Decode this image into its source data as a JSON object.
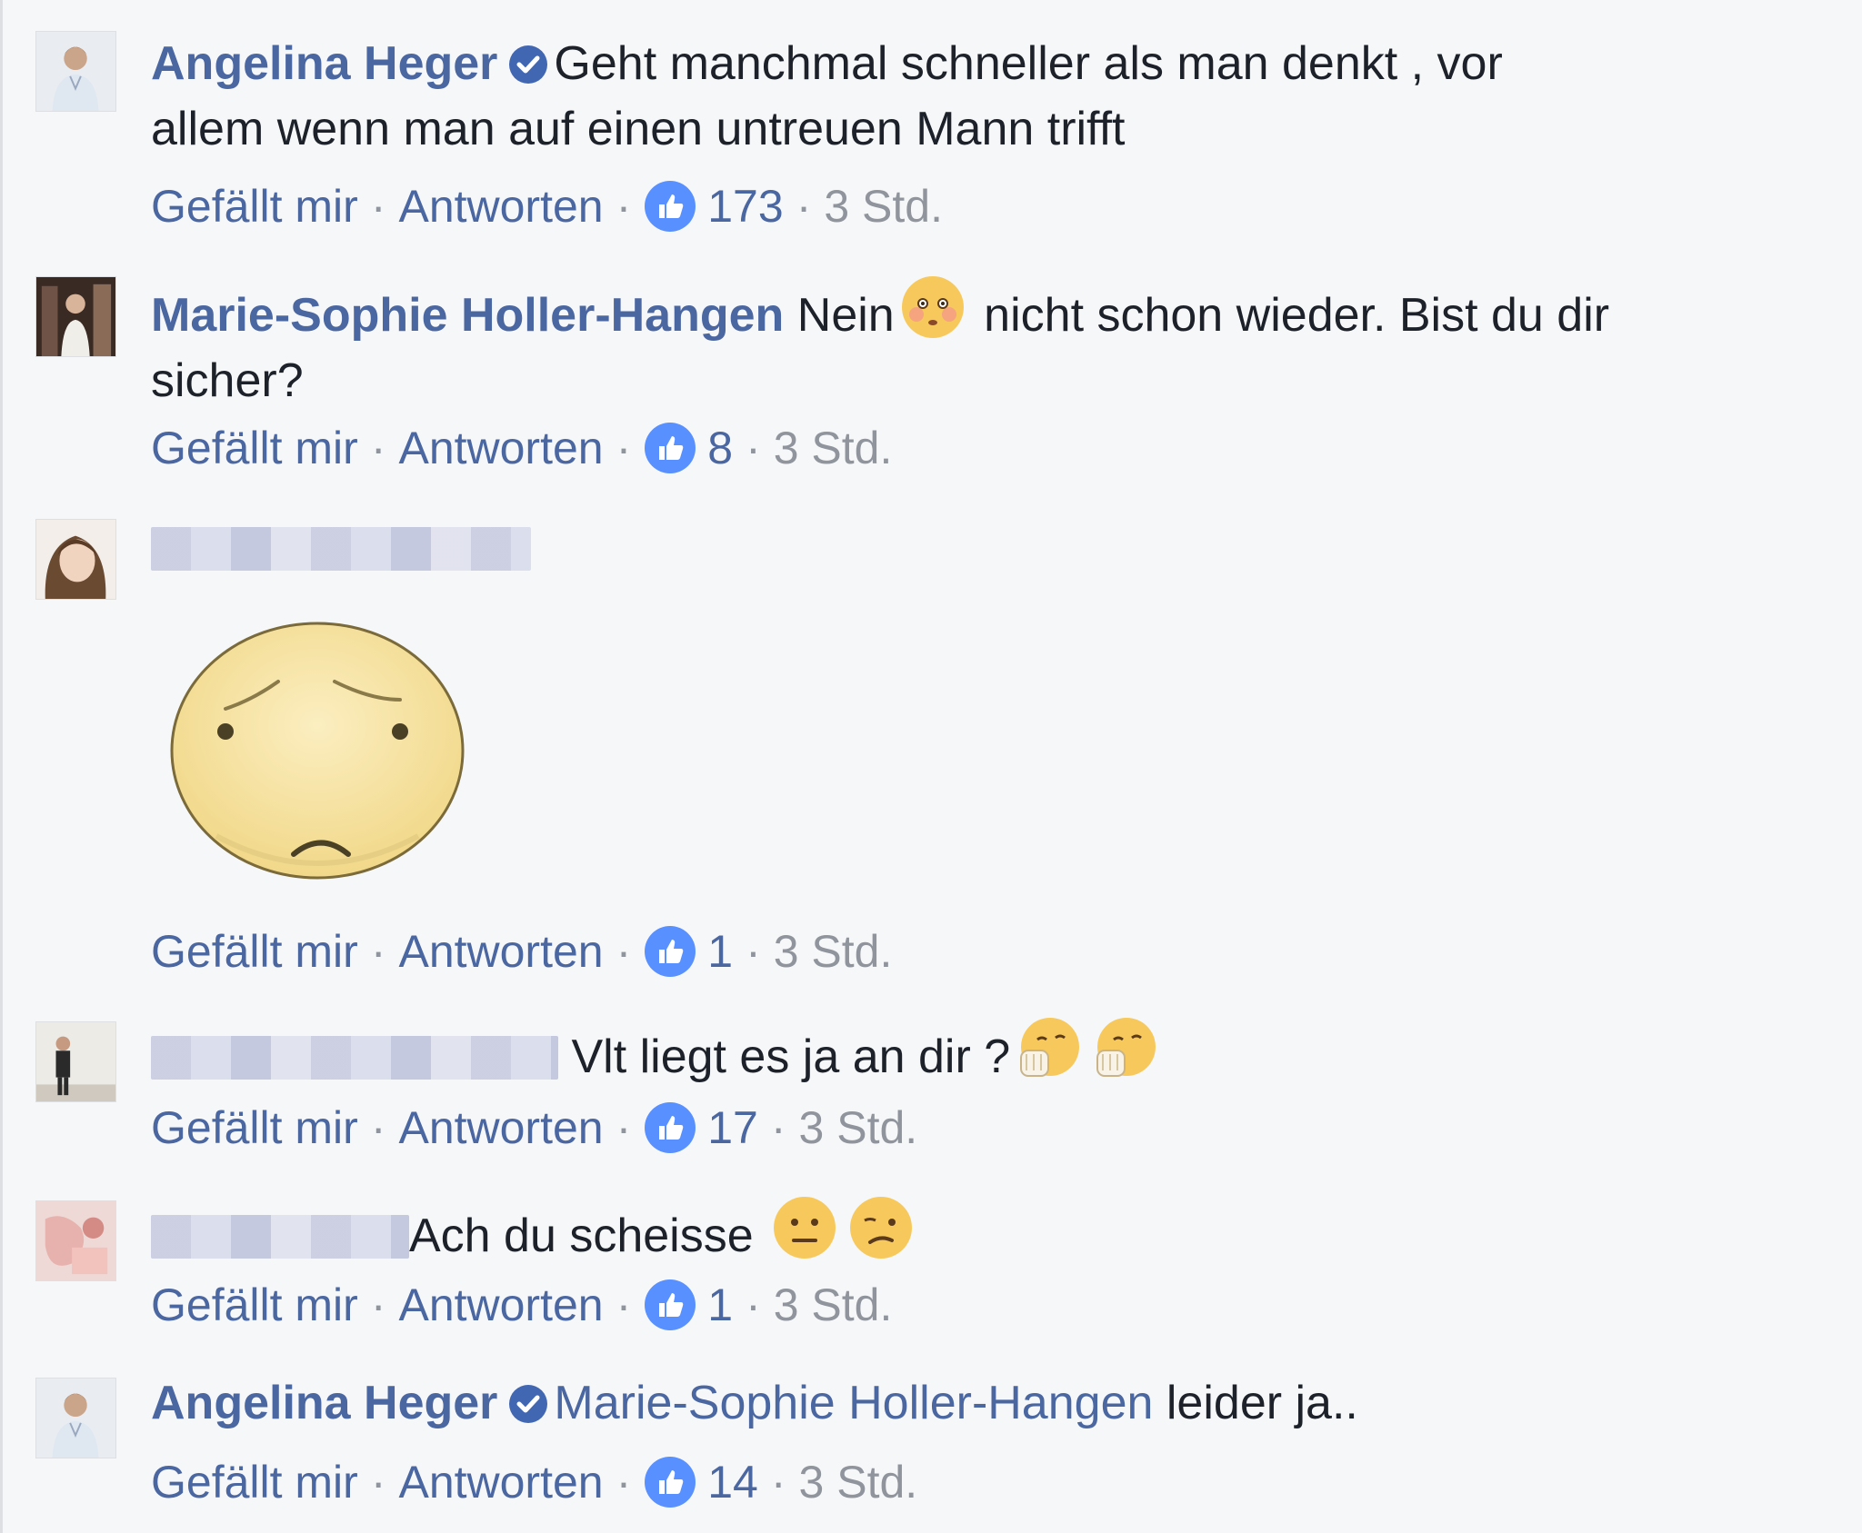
{
  "comments": [
    {
      "author": "Angelina Heger",
      "verified": true,
      "text_line1": "Geht manchmal schneller als man denkt , vor",
      "text_line2": "allem wenn man auf einen untreuen Mann trifft",
      "like_label": "Gefällt mir",
      "reply_label": "Antworten",
      "like_count": "173",
      "time": "3 Std."
    },
    {
      "author": "Marie-Sophie Holler-Hangen",
      "text_before_emoji": "Nein",
      "text_after_emoji": "nicht schon wieder. Bist du dir",
      "text_line2": "sicher?",
      "emoji": "flushed-face",
      "like_label": "Gefällt mir",
      "reply_label": "Antworten",
      "like_count": "8",
      "time": "3 Std."
    },
    {
      "author_redacted": true,
      "sticker": "worried-face-sticker",
      "like_label": "Gefällt mir",
      "reply_label": "Antworten",
      "like_count": "1",
      "time": "3 Std."
    },
    {
      "author_redacted": true,
      "text": "Vlt liegt es ja an dir ?",
      "emojis": [
        "face-with-hand-over-mouth",
        "face-with-hand-over-mouth"
      ],
      "like_label": "Gefällt mir",
      "reply_label": "Antworten",
      "like_count": "17",
      "time": "3 Std."
    },
    {
      "author_redacted": true,
      "text": "Ach du scheisse",
      "emojis": [
        "neutral-face",
        "confused-face"
      ],
      "like_label": "Gefällt mir",
      "reply_label": "Antworten",
      "like_count": "1",
      "time": "3 Std."
    },
    {
      "author": "Angelina Heger",
      "verified": true,
      "mention": "Marie-Sophie Holler-Hangen",
      "text": "leider ja..",
      "like_label": "Gefällt mir",
      "reply_label": "Antworten",
      "like_count": "14",
      "time": "3 Std."
    }
  ],
  "colors": {
    "background": "#f6f7f9",
    "author_link": "#4b67a1",
    "meta_gray": "#90949c",
    "like_blue": "#5890ff",
    "verified_blue": "#4267b2"
  }
}
